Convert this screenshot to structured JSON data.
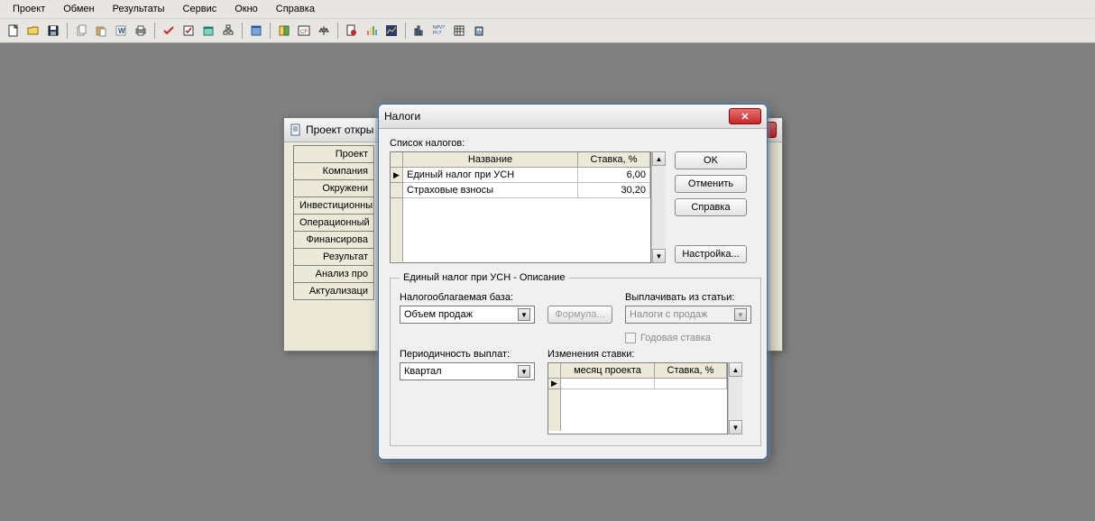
{
  "menu": {
    "items": [
      "Проект",
      "Обмен",
      "Результаты",
      "Сервис",
      "Окно",
      "Справка"
    ]
  },
  "window": {
    "title": "Проект откры"
  },
  "sidebar": {
    "tabs": [
      "Проект",
      "Компания",
      "Окружени",
      "Инвестиционны",
      "Операционный",
      "Финансирова",
      "Результат",
      "Анализ про",
      "Актуализаци"
    ]
  },
  "dialog": {
    "title": "Налоги",
    "list_label": "Список налогов:",
    "columns": {
      "name": "Название",
      "rate": "Ставка, %"
    },
    "taxes": [
      {
        "name": "Единый налог при УСН",
        "rate": "6,00"
      },
      {
        "name": "Страховые взносы",
        "rate": "30,20"
      }
    ],
    "buttons": {
      "ok": "OK",
      "cancel": "Отменить",
      "help": "Справка",
      "settings": "Настройка..."
    },
    "fieldset": {
      "legend": "Единый налог при УСН - Описание",
      "base_label": "Налогооблагаемая база:",
      "base_value": "Объем продаж",
      "formula": "Формула...",
      "pay_from_label": "Выплачивать из статьи:",
      "pay_from_value": "Налоги с продаж",
      "annual_rate": "Годовая ставка",
      "period_label": "Периодичность выплат:",
      "period_value": "Квартал",
      "changes_label": "Изменения ставки:",
      "changes_columns": {
        "month": "месяц проекта",
        "rate": "Ставка, %"
      }
    }
  }
}
